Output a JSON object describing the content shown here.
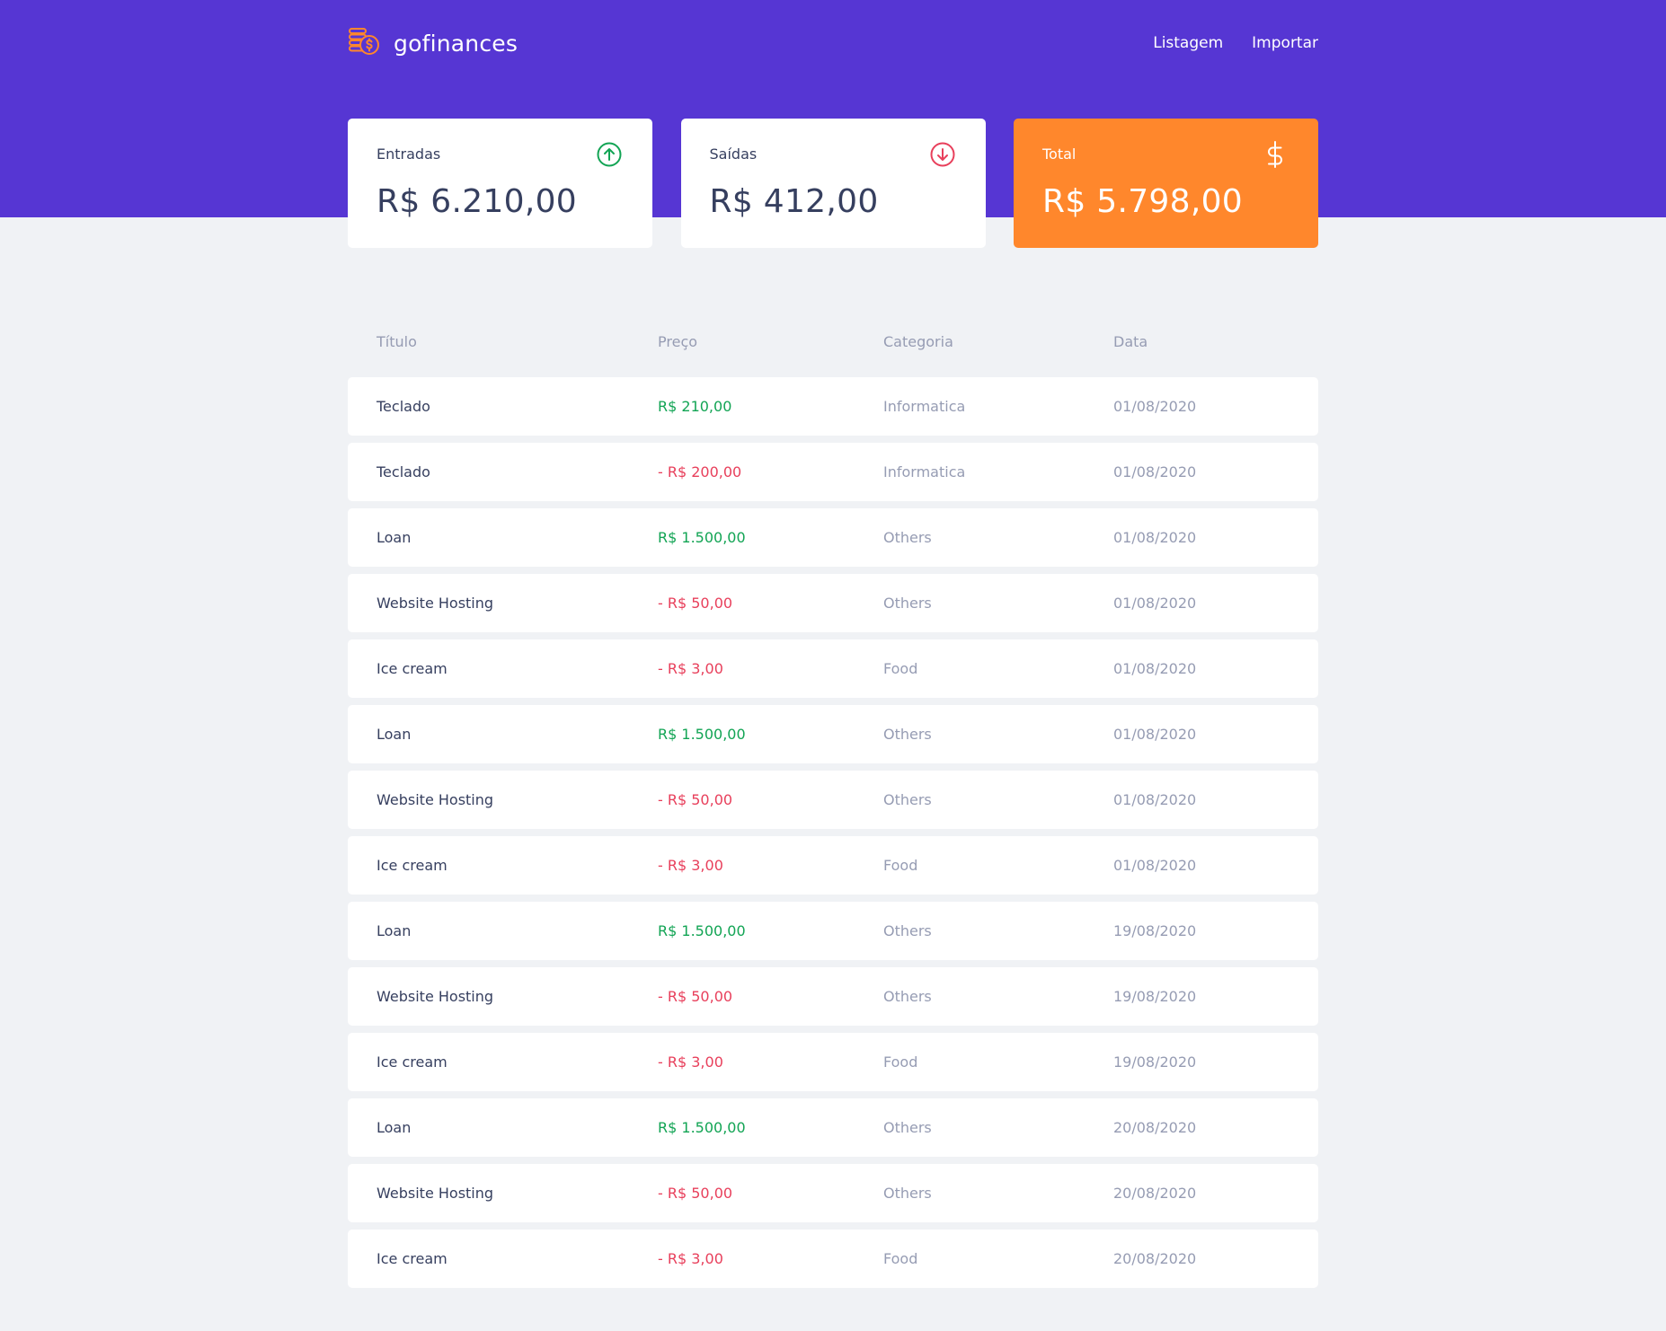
{
  "app": {
    "name": "gofinances",
    "nav": [
      "Listagem",
      "Importar"
    ]
  },
  "summary": {
    "income": {
      "label": "Entradas",
      "value": "R$ 6.210,00",
      "icon": "arrow-up-circle-icon"
    },
    "outcome": {
      "label": "Saídas",
      "value": "R$ 412,00",
      "icon": "arrow-down-circle-icon"
    },
    "total": {
      "label": "Total",
      "value": "R$ 5.798,00",
      "icon": "dollar-sign-icon"
    }
  },
  "table": {
    "headers": [
      "Título",
      "Preço",
      "Categoria",
      "Data"
    ],
    "rows": [
      {
        "title": "Teclado",
        "price": "R$ 210,00",
        "type": "income",
        "category": "Informatica",
        "date": "01/08/2020"
      },
      {
        "title": "Teclado",
        "price": "- R$ 200,00",
        "type": "outcome",
        "category": "Informatica",
        "date": "01/08/2020"
      },
      {
        "title": "Loan",
        "price": "R$ 1.500,00",
        "type": "income",
        "category": "Others",
        "date": "01/08/2020"
      },
      {
        "title": "Website Hosting",
        "price": "- R$ 50,00",
        "type": "outcome",
        "category": "Others",
        "date": "01/08/2020"
      },
      {
        "title": "Ice cream",
        "price": "- R$ 3,00",
        "type": "outcome",
        "category": "Food",
        "date": "01/08/2020"
      },
      {
        "title": "Loan",
        "price": "R$ 1.500,00",
        "type": "income",
        "category": "Others",
        "date": "01/08/2020"
      },
      {
        "title": "Website Hosting",
        "price": "- R$ 50,00",
        "type": "outcome",
        "category": "Others",
        "date": "01/08/2020"
      },
      {
        "title": "Ice cream",
        "price": "- R$ 3,00",
        "type": "outcome",
        "category": "Food",
        "date": "01/08/2020"
      },
      {
        "title": "Loan",
        "price": "R$ 1.500,00",
        "type": "income",
        "category": "Others",
        "date": "19/08/2020"
      },
      {
        "title": "Website Hosting",
        "price": "- R$ 50,00",
        "type": "outcome",
        "category": "Others",
        "date": "19/08/2020"
      },
      {
        "title": "Ice cream",
        "price": "- R$ 3,00",
        "type": "outcome",
        "category": "Food",
        "date": "19/08/2020"
      },
      {
        "title": "Loan",
        "price": "R$ 1.500,00",
        "type": "income",
        "category": "Others",
        "date": "20/08/2020"
      },
      {
        "title": "Website Hosting",
        "price": "- R$ 50,00",
        "type": "outcome",
        "category": "Others",
        "date": "20/08/2020"
      },
      {
        "title": "Ice cream",
        "price": "- R$ 3,00",
        "type": "outcome",
        "category": "Food",
        "date": "20/08/2020"
      }
    ]
  },
  "colors": {
    "header": "#5636D3",
    "background": "#F0F2F5",
    "total_card": "#FF872C",
    "income": "#12A454",
    "outcome": "#E83F5B",
    "text": "#363F5F",
    "muted": "#969CB3"
  }
}
